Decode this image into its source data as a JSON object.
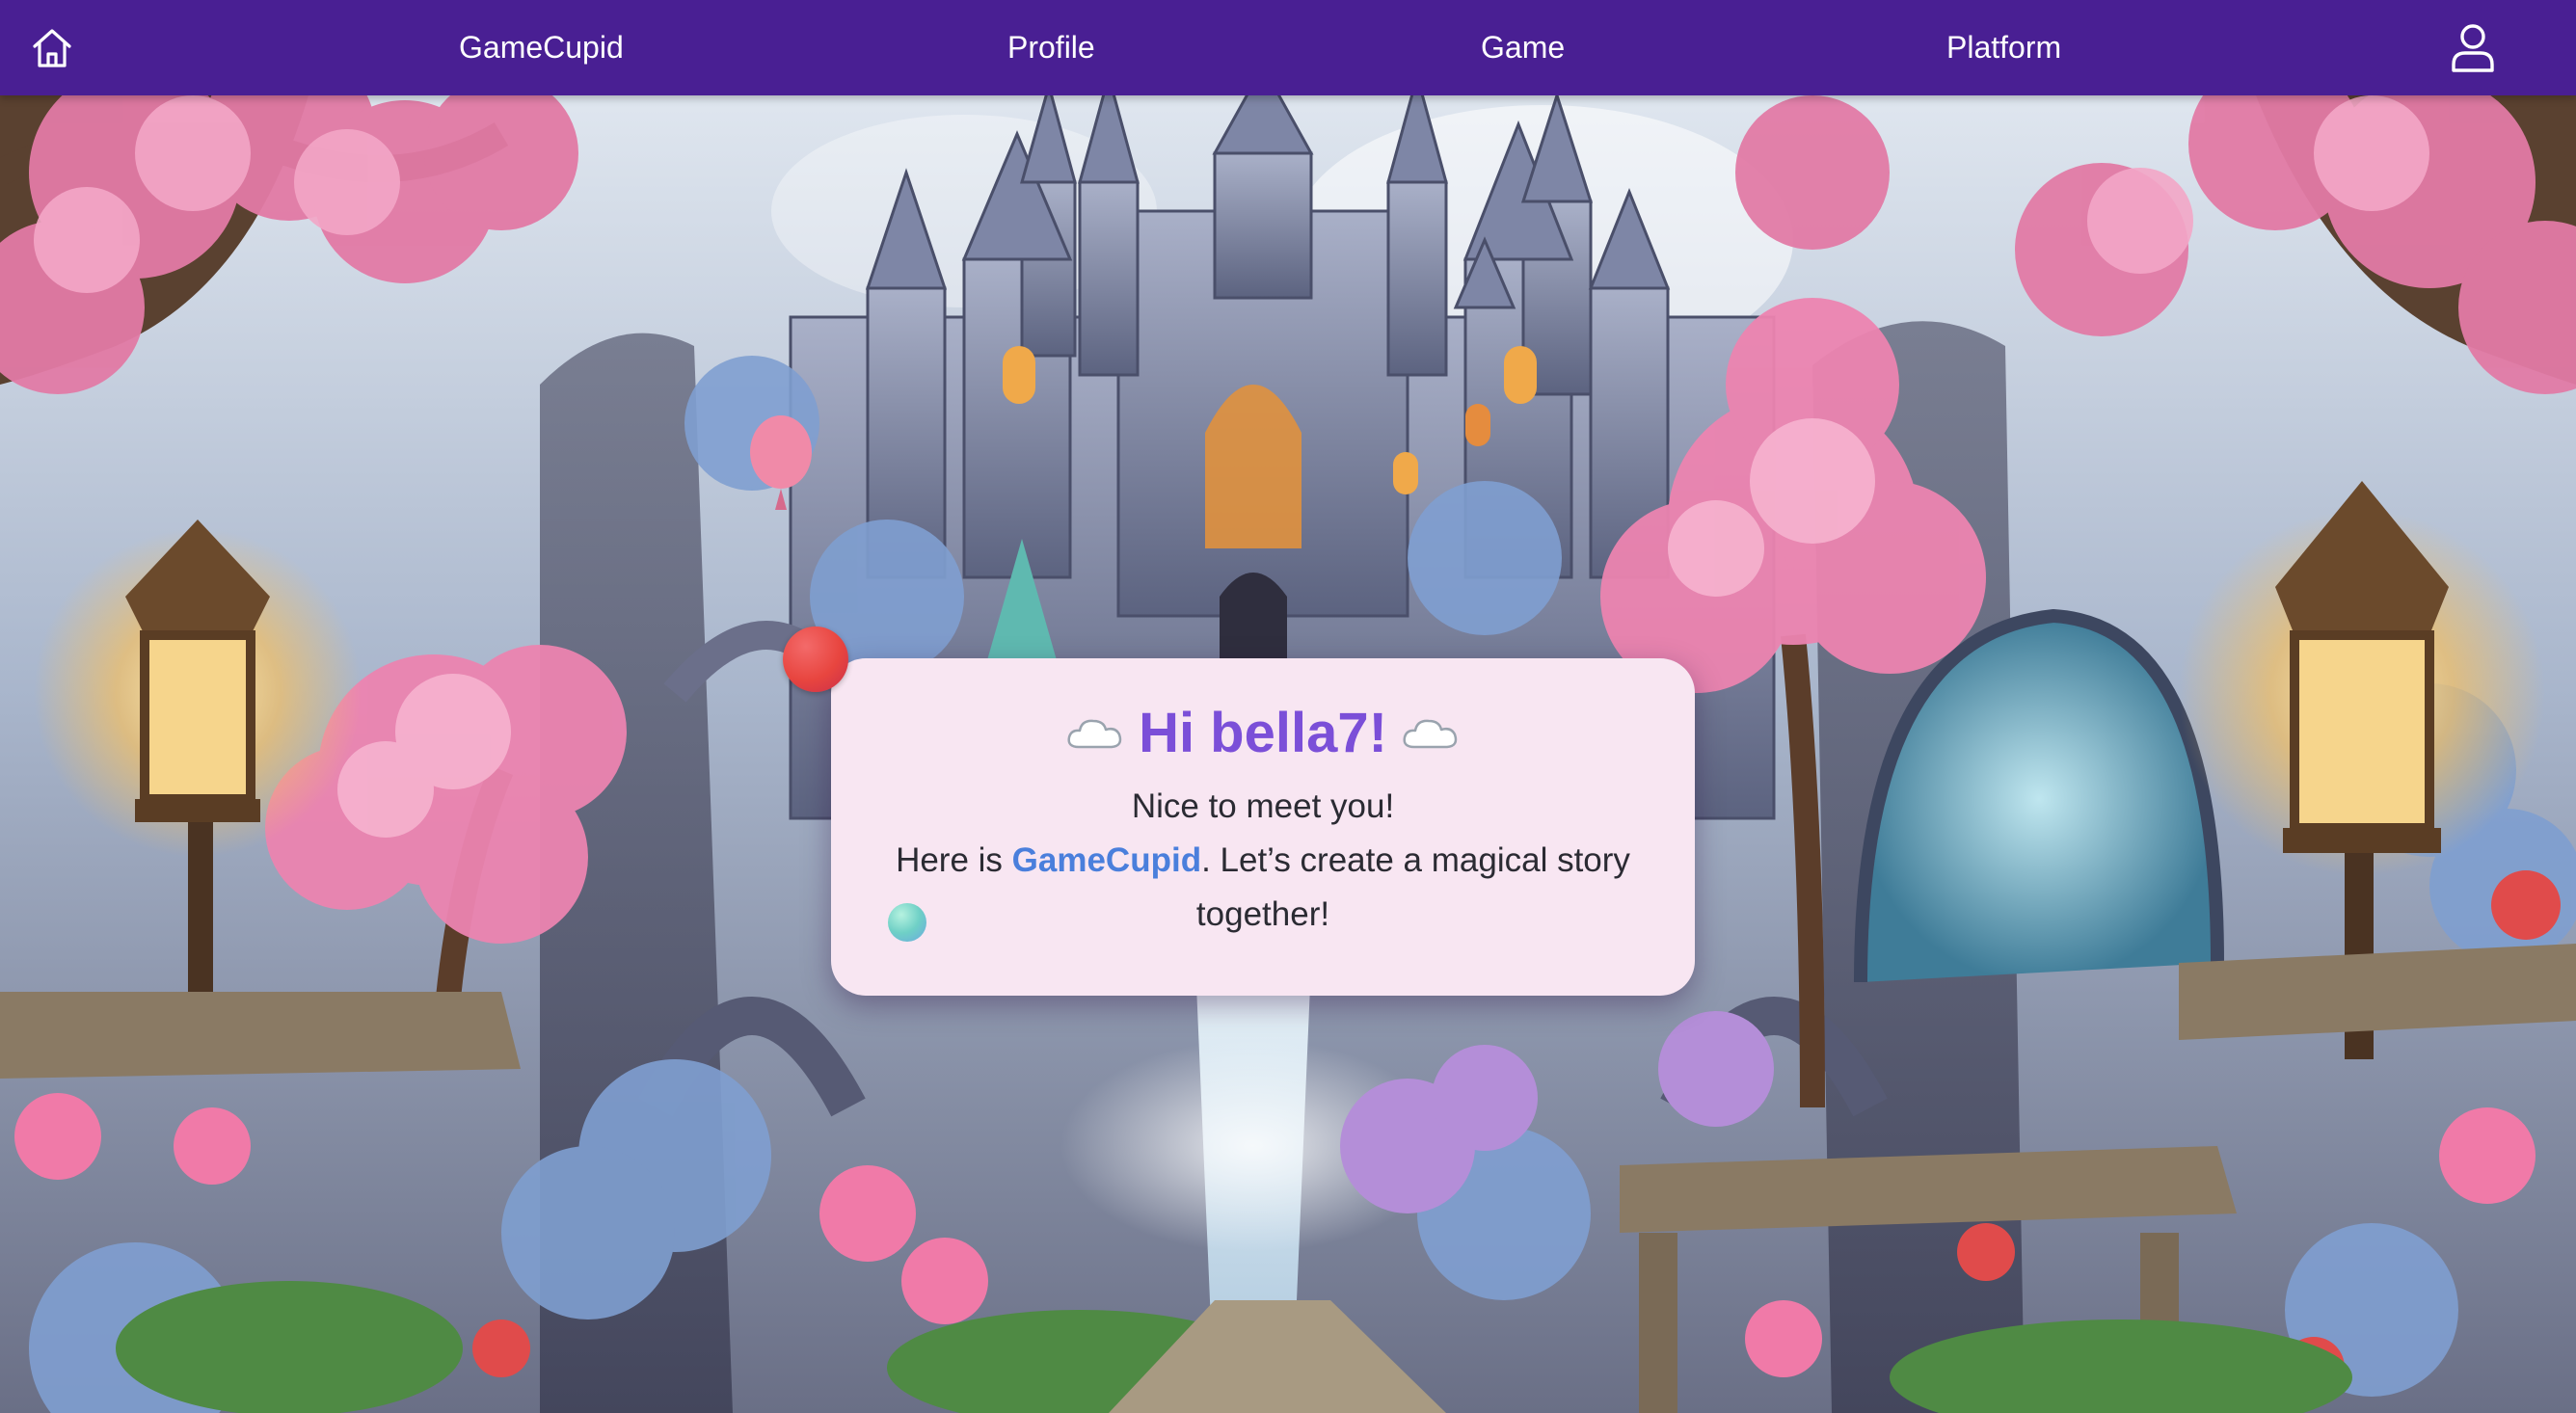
{
  "nav": {
    "home_icon": "home-icon",
    "brand": "GameCupid",
    "profile": "Profile",
    "game": "Game",
    "platform": "Platform",
    "user_icon": "user-icon"
  },
  "dialog": {
    "greeting": "Hi bella7!",
    "greeting_decoration_icon": "cloud-icon",
    "line1": "Nice to meet you!",
    "line2_prefix": "Here is ",
    "line2_brand": "GameCupid",
    "line2_suffix": ". Let’s create a magical story together!"
  },
  "colors": {
    "navbar": "#491f93",
    "dialog_bg": "#f8e6f2",
    "greeting": "#7b4fd8",
    "brand_highlight": "#4a7fdc"
  }
}
